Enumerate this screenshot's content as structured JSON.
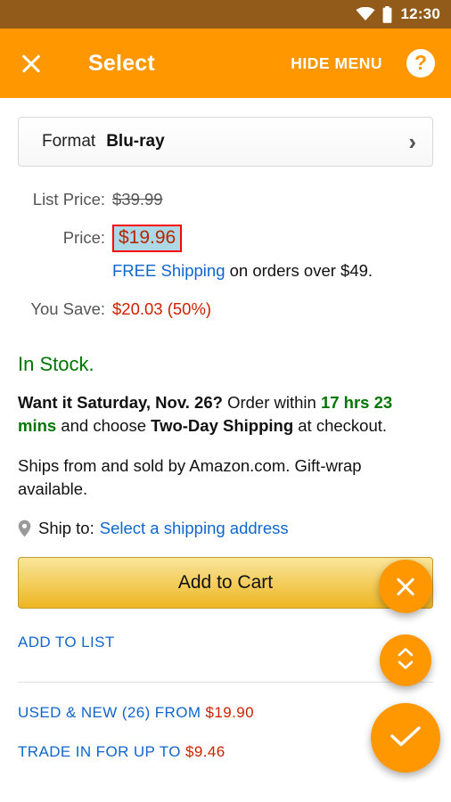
{
  "status_bar": {
    "time": "12:30",
    "wifi_icon": "wifi-icon",
    "battery_icon": "battery-icon"
  },
  "header": {
    "close_icon": "close-icon",
    "title": "Select",
    "hide_menu_label": "HIDE MENU",
    "help_icon": "?",
    "background_color": "#FF9800"
  },
  "format_selector": {
    "label": "Format",
    "value": "Blu-ray",
    "chevron_icon": "chevron-right-icon"
  },
  "pricing": {
    "list_price_label": "List Price:",
    "list_price_value": "$39.99",
    "price_label": "Price:",
    "price_value": "$19.96",
    "price_highlight_color": "#ADD8E6",
    "price_border_color": "#FF0000",
    "free_shipping_link": "FREE Shipping",
    "free_shipping_rest": "on orders over $49.",
    "you_save_label": "You Save:",
    "you_save_value": "$20.03 (50%)",
    "save_color": "#CC2200"
  },
  "availability": {
    "in_stock": "In Stock.",
    "in_stock_color": "#007600",
    "want_it_prefix": "Want it Saturday, Nov. 26?",
    "order_within": "Order within",
    "countdown": "17 hrs 23 mins",
    "and_choose": "and choose",
    "shipping_method": "Two-Day Shipping",
    "at_checkout": "at checkout.",
    "ships_from": "Ships from and sold by Amazon.com. Gift-wrap available."
  },
  "ship_to": {
    "pin_icon": "location-pin-icon",
    "label": "Ship to:",
    "link": "Select a shipping address"
  },
  "actions": {
    "add_to_cart": "Add to Cart",
    "add_to_list": "ADD TO LIST"
  },
  "bottom_links": {
    "used_new_label": "USED & NEW (26) FROM",
    "used_new_price": "$19.90",
    "trade_in_label": "TRADE IN FOR UP TO",
    "trade_in_price": "$9.46"
  },
  "fabs": {
    "close_icon": "close-icon",
    "scroll_icon": "chevron-up-down-icon",
    "confirm_icon": "check-icon",
    "color": "#FF9800"
  }
}
